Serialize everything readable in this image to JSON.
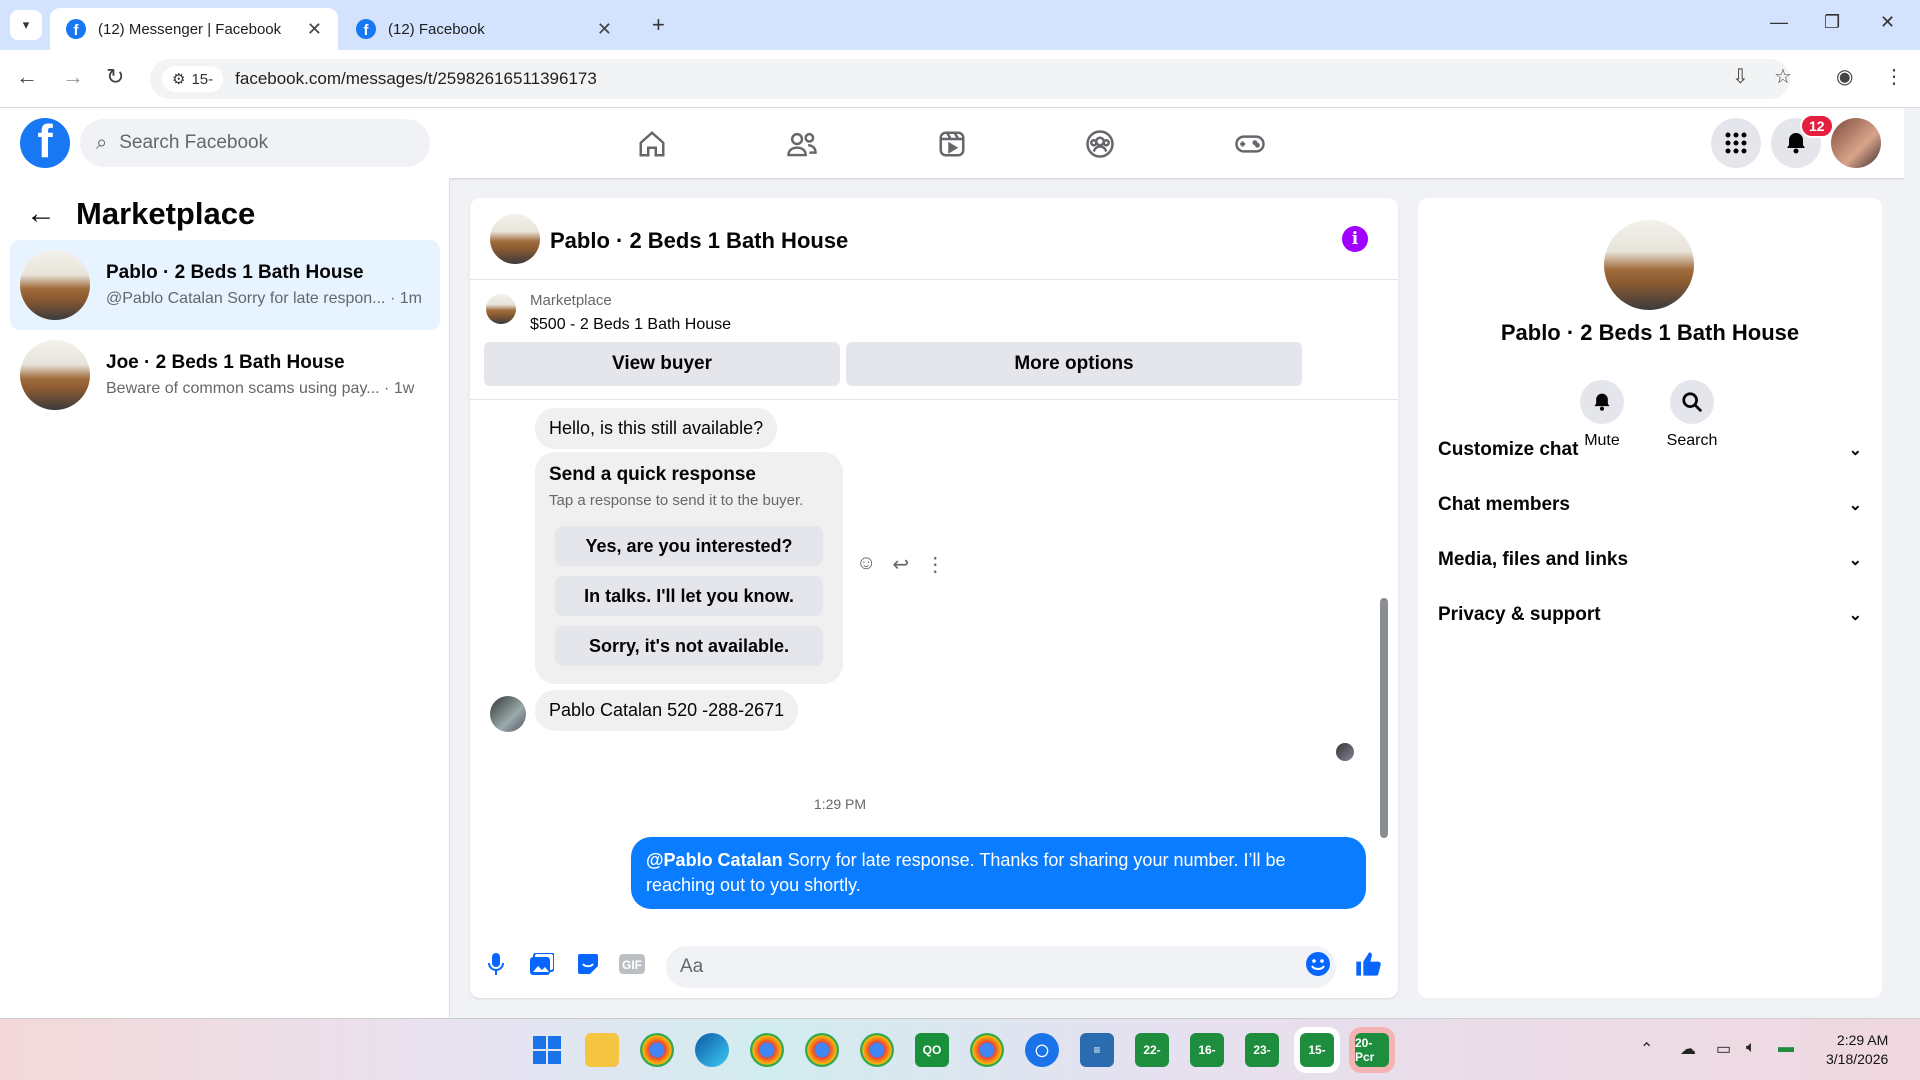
{
  "browser": {
    "tabs": [
      {
        "title": "(12) Messenger | Facebook",
        "active": true
      },
      {
        "title": "(12) Facebook",
        "active": false
      }
    ],
    "site_chip": "15-",
    "url": "facebook.com/messages/t/25982616511396173"
  },
  "fb": {
    "search_placeholder": "Search Facebook",
    "notification_count": "12"
  },
  "left": {
    "title": "Marketplace",
    "chats": [
      {
        "title": "Pablo · 2 Beds 1 Bath House",
        "preview": "@Pablo Catalan Sorry for late respon...",
        "time": "· 1m"
      },
      {
        "title": "Joe · 2 Beds 1 Bath House",
        "preview": "Beware of common scams using pay...",
        "time": "· 1w"
      }
    ]
  },
  "conversation": {
    "title": "Pablo · 2 Beds 1 Bath House",
    "listing_label": "Marketplace",
    "listing_price": "$500 - 2 Beds 1 Bath House",
    "buttons": {
      "view_buyer": "View buyer",
      "more_options": "More options"
    },
    "messages": {
      "first": "Hello, is this still available?",
      "quick_title": "Send a quick response",
      "quick_sub": "Tap a response to send it to the buyer.",
      "quick_options": [
        "Yes, are you interested?",
        "In talks. I'll let you know.",
        "Sorry, it's not available."
      ],
      "phone": "Pablo Catalan 520 -288-2671",
      "timestamp": "1:29 PM",
      "out_mention": "@Pablo Catalan",
      "out_text": " Sorry for late response. Thanks for sharing your number. I’ll be reaching out to you shortly."
    },
    "composer_placeholder": "Aa"
  },
  "details": {
    "title": "Pablo · 2 Beds 1 Bath House",
    "actions": [
      "Mute",
      "Search"
    ],
    "sections": [
      "Customize chat",
      "Chat members",
      "Media, files and links",
      "Privacy & support"
    ]
  },
  "taskbar": {
    "apps": [
      "22-",
      "16-",
      "23-",
      "15-",
      "20-Pcr"
    ],
    "time": "2:29 AM",
    "date": "3/18/2026"
  },
  "colors": {
    "fb_blue": "#1877f2",
    "messenger_blue": "#0a7cff",
    "info_purple": "#a100ff",
    "badge_red": "#e41e3f"
  }
}
